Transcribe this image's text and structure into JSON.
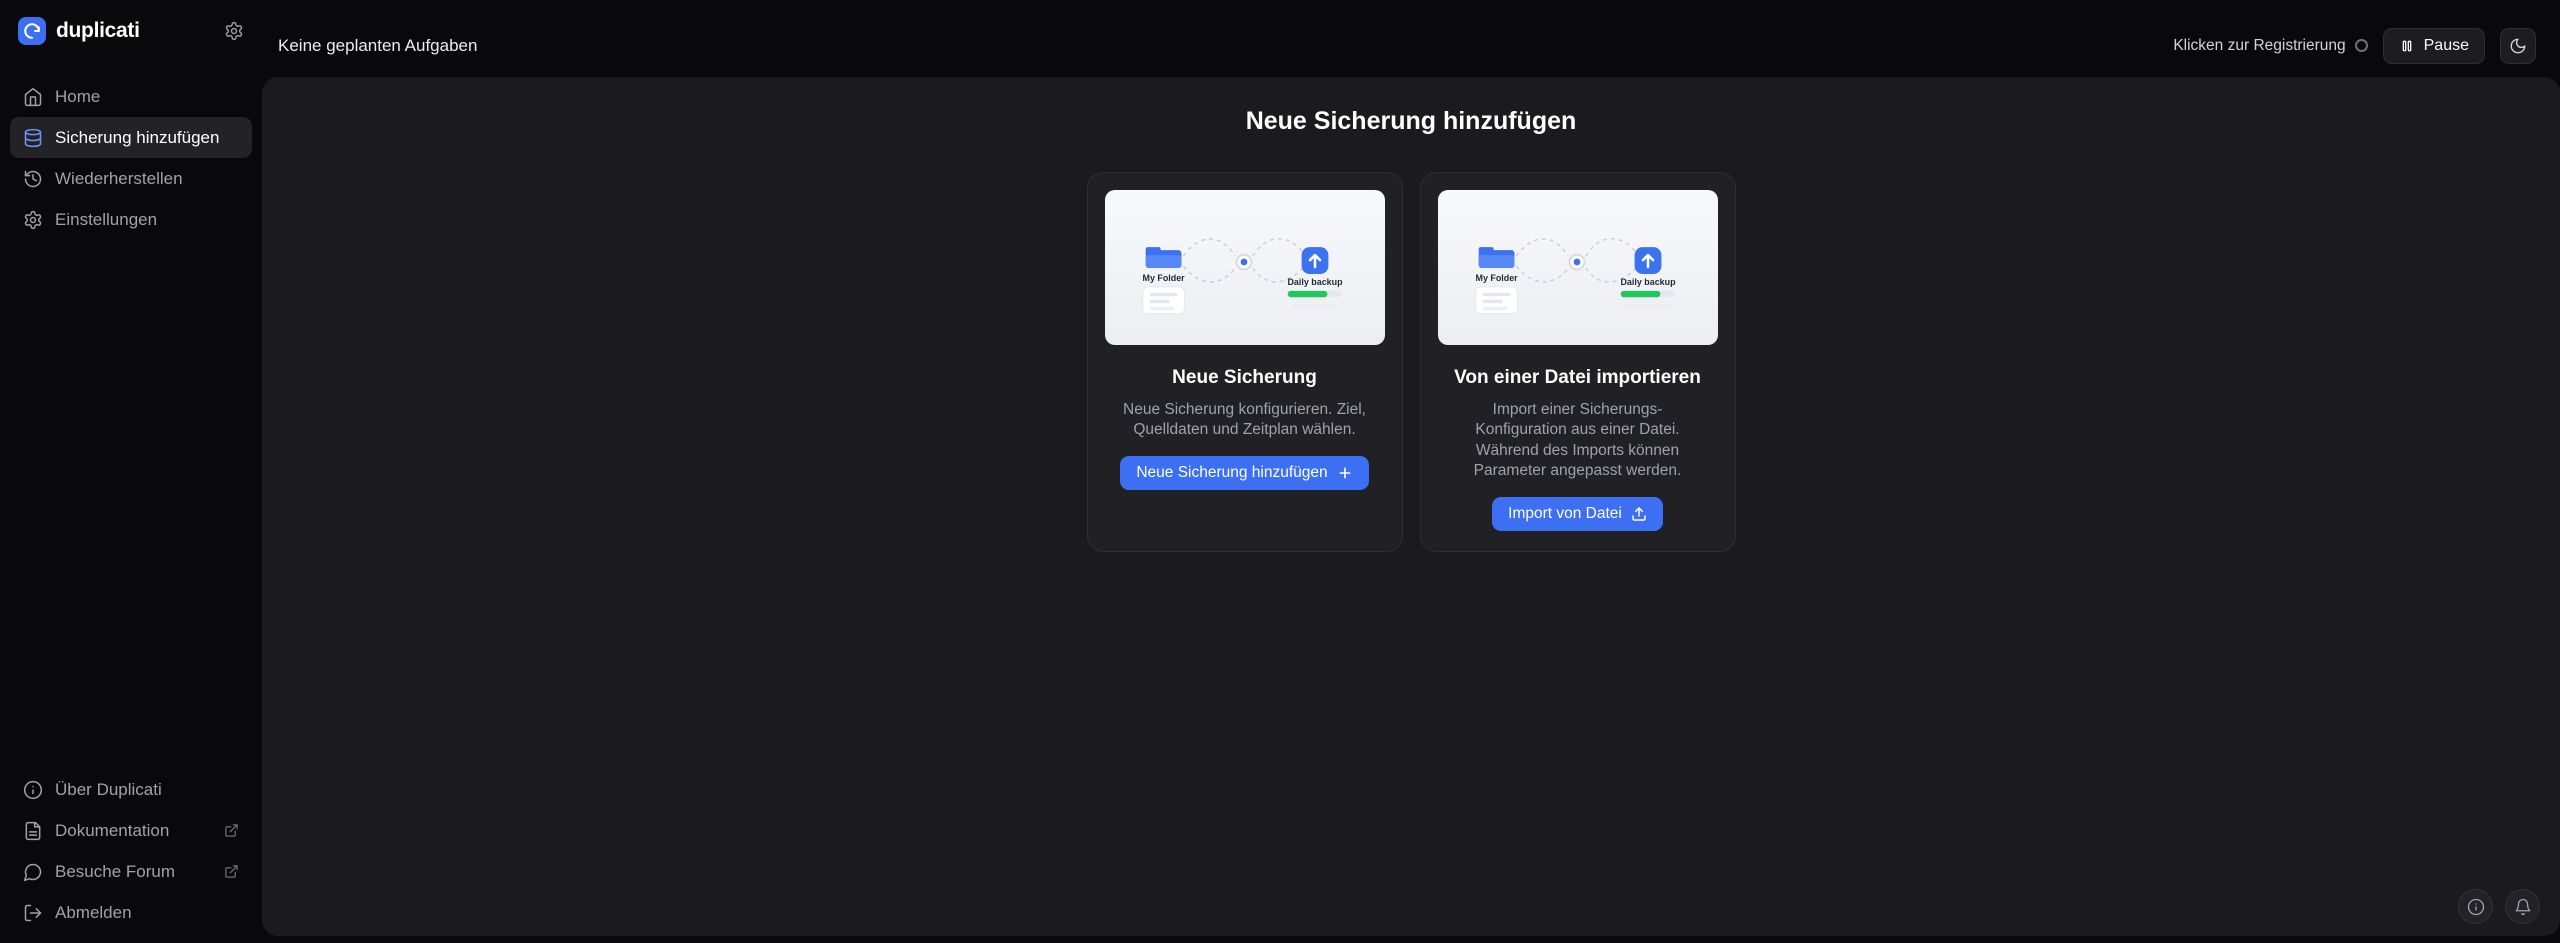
{
  "colors": {
    "accent": "#3d6ff2",
    "success": "#22c55e",
    "panel_bg": "#1b1b1f",
    "sidebar_bg": "#09090b"
  },
  "brand": {
    "name": "duplicati"
  },
  "sidebar": {
    "nav": [
      {
        "label": "Home",
        "active": false
      },
      {
        "label": "Sicherung hinzufügen",
        "active": true
      },
      {
        "label": "Wiederherstellen",
        "active": false
      },
      {
        "label": "Einstellungen",
        "active": false
      }
    ],
    "footer": [
      {
        "label": "Über Duplicati",
        "external": false
      },
      {
        "label": "Dokumentation",
        "external": true
      },
      {
        "label": "Besuche Forum",
        "external": true
      },
      {
        "label": "Abmelden",
        "external": false
      }
    ]
  },
  "topbar": {
    "status": "Keine geplanten Aufgaben",
    "register": "Klicken zur Registrierung",
    "pause": "Pause"
  },
  "main": {
    "title": "Neue Sicherung hinzufügen",
    "cards": [
      {
        "title": "Neue Sicherung",
        "description": "Neue Sicherung konfigurieren. Ziel, Quelldaten und Zeitplan wählen.",
        "button": "Neue Sicherung hinzufügen"
      },
      {
        "title": "Von einer Datei importieren",
        "description": "Import einer Sicherungs-Konfiguration aus einer Datei. Während des Imports können Parameter angepasst werden.",
        "button": "Import von Datei"
      }
    ],
    "illustration": {
      "source_label": "My Folder",
      "target_label": "Daily backup"
    }
  }
}
